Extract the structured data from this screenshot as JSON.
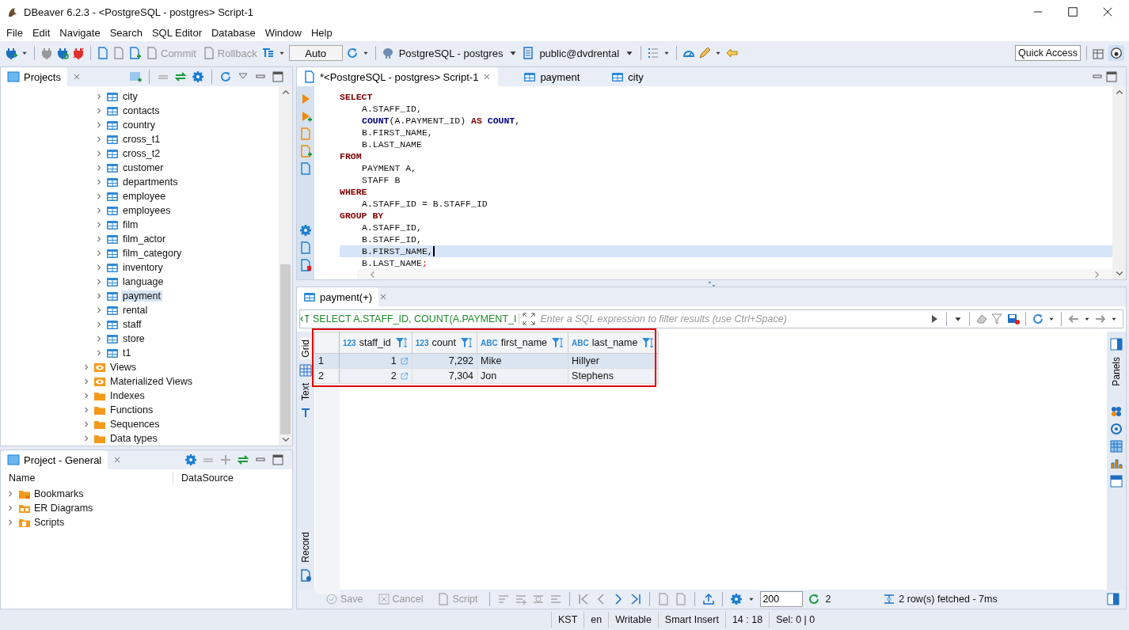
{
  "window": {
    "title": "DBeaver 6.2.3 - <PostgreSQL - postgres> Script-1"
  },
  "menu": [
    "File",
    "Edit",
    "Navigate",
    "Search",
    "SQL Editor",
    "Database",
    "Window",
    "Help"
  ],
  "toolbar": {
    "commit": {
      "label": "Commit",
      "disabled": true
    },
    "rollback": {
      "label": "Rollback",
      "disabled": true
    },
    "mode": "Auto",
    "connection": "PostgreSQL - postgres",
    "schema": "public@dvdrental",
    "quick_access": "Quick Access"
  },
  "projects": {
    "title": "Projects",
    "items": [
      {
        "label": "city",
        "kind": "table",
        "selected": false
      },
      {
        "label": "contacts",
        "kind": "table",
        "selected": false
      },
      {
        "label": "country",
        "kind": "table",
        "selected": false
      },
      {
        "label": "cross_t1",
        "kind": "table",
        "selected": false
      },
      {
        "label": "cross_t2",
        "kind": "table",
        "selected": false
      },
      {
        "label": "customer",
        "kind": "table",
        "selected": false
      },
      {
        "label": "departments",
        "kind": "table",
        "selected": false
      },
      {
        "label": "employee",
        "kind": "table",
        "selected": false
      },
      {
        "label": "employees",
        "kind": "table",
        "selected": false
      },
      {
        "label": "film",
        "kind": "table",
        "selected": false
      },
      {
        "label": "film_actor",
        "kind": "table",
        "selected": false
      },
      {
        "label": "film_category",
        "kind": "table",
        "selected": false
      },
      {
        "label": "inventory",
        "kind": "table",
        "selected": false
      },
      {
        "label": "language",
        "kind": "table",
        "selected": false
      },
      {
        "label": "payment",
        "kind": "table",
        "selected": true
      },
      {
        "label": "rental",
        "kind": "table",
        "selected": false
      },
      {
        "label": "staff",
        "kind": "table",
        "selected": false
      },
      {
        "label": "store",
        "kind": "table",
        "selected": false
      },
      {
        "label": "t1",
        "kind": "table",
        "selected": false
      },
      {
        "label": "Views",
        "kind": "view",
        "selected": false
      },
      {
        "label": "Materialized Views",
        "kind": "view",
        "selected": false
      },
      {
        "label": "Indexes",
        "kind": "folder",
        "selected": false
      },
      {
        "label": "Functions",
        "kind": "folder",
        "selected": false
      },
      {
        "label": "Sequences",
        "kind": "folder",
        "selected": false
      },
      {
        "label": "Data types",
        "kind": "folder",
        "selected": false
      }
    ]
  },
  "project_general": {
    "title": "Project - General",
    "columns": [
      "Name",
      "DataSource"
    ],
    "items": [
      {
        "label": "Bookmarks",
        "kind": "bookmarks"
      },
      {
        "label": "ER Diagrams",
        "kind": "diagrams"
      },
      {
        "label": "Scripts",
        "kind": "scripts"
      }
    ]
  },
  "editor_tabs": [
    {
      "label": "*<PostgreSQL - postgres> Script-1",
      "kind": "script",
      "selected": true
    },
    {
      "label": "payment",
      "kind": "table",
      "selected": false
    },
    {
      "label": "city",
      "kind": "table",
      "selected": false
    }
  ],
  "sql_lines": [
    {
      "kind": "clause",
      "current": false,
      "tokens": [
        {
          "text": "SELECT",
          "kind": "keyword"
        }
      ]
    },
    {
      "kind": "item",
      "current": false,
      "tokens": [
        {
          "text": "A.STAFF_ID,",
          "kind": "plain"
        }
      ]
    },
    {
      "kind": "item",
      "current": false,
      "tokens": [
        {
          "text": "COUNT",
          "kind": "function"
        },
        {
          "text": "(A.PAYMENT_ID) ",
          "kind": "plain"
        },
        {
          "text": "AS",
          "kind": "keyword"
        },
        {
          "text": " COUNT",
          "kind": "function"
        },
        {
          "text": ",",
          "kind": "plain"
        }
      ]
    },
    {
      "kind": "item",
      "current": false,
      "tokens": [
        {
          "text": "B.FIRST_NAME,",
          "kind": "plain"
        }
      ]
    },
    {
      "kind": "item",
      "current": false,
      "tokens": [
        {
          "text": "B.LAST_NAME",
          "kind": "plain"
        }
      ]
    },
    {
      "kind": "clause",
      "current": false,
      "tokens": [
        {
          "text": "FROM",
          "kind": "keyword"
        }
      ]
    },
    {
      "kind": "item",
      "current": false,
      "tokens": [
        {
          "text": "PAYMENT A,",
          "kind": "plain"
        }
      ]
    },
    {
      "kind": "item",
      "current": false,
      "tokens": [
        {
          "text": "STAFF B",
          "kind": "plain"
        }
      ]
    },
    {
      "kind": "clause",
      "current": false,
      "tokens": [
        {
          "text": "WHERE",
          "kind": "keyword"
        }
      ]
    },
    {
      "kind": "item",
      "current": false,
      "tokens": [
        {
          "text": "A.STAFF_ID = B.STAFF_ID",
          "kind": "plain"
        }
      ]
    },
    {
      "kind": "clause",
      "current": false,
      "tokens": [
        {
          "text": "GROUP BY",
          "kind": "keyword"
        }
      ]
    },
    {
      "kind": "item",
      "current": false,
      "tokens": [
        {
          "text": "A.STAFF_ID,",
          "kind": "plain"
        }
      ]
    },
    {
      "kind": "item",
      "current": false,
      "tokens": [
        {
          "text": "B.STAFF_ID,",
          "kind": "plain"
        }
      ]
    },
    {
      "kind": "item",
      "current": true,
      "tokens": [
        {
          "text": "B.FIRST_NAME,",
          "kind": "plain"
        }
      ]
    },
    {
      "kind": "item",
      "current": false,
      "tokens": [
        {
          "text": "B.LAST_NAME",
          "kind": "plain"
        },
        {
          "text": ";",
          "kind": "error"
        }
      ]
    }
  ],
  "results": {
    "tab": "payment(+)",
    "query": "SELECT A.STAFF_ID, COUNT(A.PAYMENT_I",
    "filter_placeholder": "Enter a SQL expression to filter results (use Ctrl+Space)",
    "side_tabs": [
      {
        "label": "Grid",
        "selected": true
      },
      {
        "label": "Text",
        "selected": false
      },
      {
        "label": "Record",
        "selected": false
      }
    ],
    "panels_label": "Panels",
    "highlighted": true,
    "columns": [
      {
        "type_label": "123",
        "name": "staff_id",
        "kind": "reference"
      },
      {
        "type_label": "123",
        "name": "count",
        "kind": "number"
      },
      {
        "type_label": "ABC",
        "name": "first_name",
        "kind": "text"
      },
      {
        "type_label": "ABC",
        "name": "last_name",
        "kind": "text"
      }
    ],
    "rows": [
      {
        "number": "1",
        "cells": [
          "1",
          "7,292",
          "Mike",
          "Hillyer"
        ]
      },
      {
        "number": "2",
        "cells": [
          "2",
          "7,304",
          "Jon",
          "Stephens"
        ]
      }
    ],
    "footer": {
      "save": "Save",
      "cancel": "Cancel",
      "script": "Script",
      "fetch_size": "200",
      "refresh_count": "2",
      "status": "2 row(s) fetched - 7ms"
    }
  },
  "status_bar": [
    "KST",
    "en",
    "Writable",
    "Smart Insert",
    "14 : 18",
    "Sel: 0 | 0"
  ]
}
